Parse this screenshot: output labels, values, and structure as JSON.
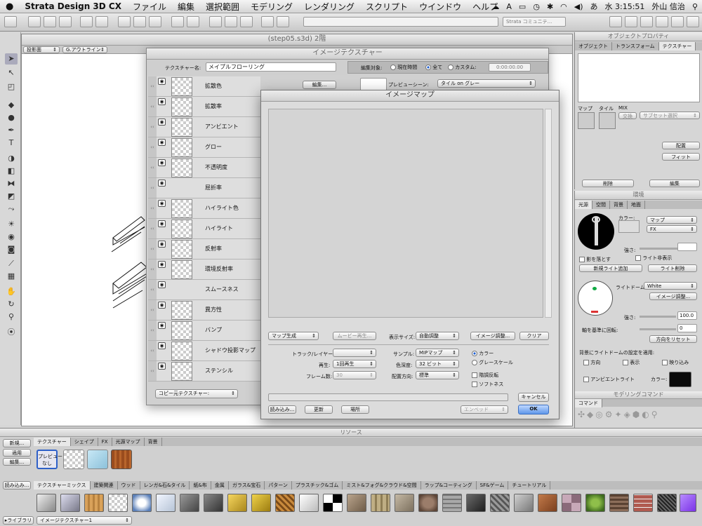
{
  "menubar": {
    "app": "Strata Design 3D CX",
    "items": [
      "ファイル",
      "編集",
      "選択範囲",
      "モデリング",
      "レンダリング",
      "スクリプト",
      "ウインドウ",
      "ヘルプ"
    ],
    "clock": "水 3:15:51",
    "user": "外山 信治"
  },
  "toolbar": {
    "search_placeholder": "Strata コミュニテ..."
  },
  "viewport": {
    "title": "(step05.s3d) 2階",
    "view_popup": "投影面",
    "render_popup": "G.アウトライン"
  },
  "image_texture": {
    "title": "イメージテクスチャー",
    "name_label": "テクスチャー名:",
    "name_value": "メイプルフローリング",
    "edit_target_label": "編集対象:",
    "target_current": "現在時間",
    "target_all": "全て",
    "target_custom": "カスタム:",
    "time_value": "0:00:00.00",
    "preview_label": "プレビューシーン:",
    "preview_value": "タイル on グレー",
    "edit_button": "編集...",
    "channels": [
      "拡散色",
      "拡散率",
      "アンビエント",
      "グロー",
      "不透明度",
      "屈折率",
      "ハイライト色",
      "ハイライト",
      "反射率",
      "環境反射率",
      "スムースネス",
      "異方性",
      "バンプ",
      "シャドウ投影マップ",
      "ステンシル"
    ],
    "copy_source": "コピー元テクスチャー:"
  },
  "image_map": {
    "title": "イメージマップ",
    "map_create": "マップ生成",
    "movie_play": "ムービー再生...",
    "display_size_label": "表示サイズ:",
    "display_size": "自動調整",
    "image_adjust": "イメージ調整...",
    "clear": "クリア",
    "track_label": "トラック/レイヤー:",
    "playback_label": "再生:",
    "playback_value": "1回再生",
    "frames_label": "フレーム数:",
    "frames_value": "30",
    "sample_label": "サンプル:",
    "sample_value": "MIPマップ",
    "depth_label": "色深度:",
    "depth_value": "32 ビット",
    "direction_label": "配置方向:",
    "direction_value": "標準",
    "color": "カラー",
    "grayscale": "グレースケール",
    "invert": "階調反転",
    "softness": "ソフトネス",
    "load": "読み込み...",
    "update": "更新",
    "location": "場所",
    "import": "エンベッド",
    "cancel": "キャンセル",
    "ok": "OK"
  },
  "properties": {
    "title": "オブジェクトプロパティ",
    "tabs": [
      "オブジェクト",
      "トランスフォーム",
      "テクスチャー"
    ],
    "map_labels": [
      "マップ",
      "タイル",
      "MIX"
    ],
    "swap": "交換",
    "subset": "サブセット選択",
    "place": "配置",
    "fit": "フィット",
    "delete": "削除",
    "edit": "編集"
  },
  "environment": {
    "title": "環境",
    "tabs": [
      "光源",
      "空間",
      "背景",
      "地面"
    ],
    "color_label": "カラー:",
    "map_popup": "マップ",
    "fx_popup": "FX",
    "strength_label": "強さ:",
    "cast_shadow": "影を落とす",
    "light_hidden": "ライト非表示",
    "add_light": "新規ライト追加",
    "delete_light": "ライト削除",
    "dome_label": "ライトドーム:",
    "dome_value": "White",
    "image_adjust": "イメージ調整...",
    "strength2_label": "強さ:",
    "strength_value": "100.0",
    "rotate_label": "軸を基準に回転:",
    "rotate_value": "0",
    "reset_direction": "方向をリセット",
    "apply_label": "背景にライトドームの設定を適用:",
    "apply_direction": "方向",
    "apply_show": "表示",
    "apply_blur": "映り込み",
    "ambient": "アンビエントライト",
    "ambient_color_label": "カラー:"
  },
  "modeling": {
    "title": "モデリングコマンド",
    "tab": "コマンド"
  },
  "resources": {
    "title": "リソース",
    "tabs": [
      "テクスチャー",
      "シェイプ",
      "FX",
      "光源マップ",
      "背景"
    ],
    "new": "新規...",
    "apply": "適用",
    "edit": "編集...",
    "preview_none": "プレビュー\nなし",
    "load": "読み込み...",
    "lib_tabs": [
      "テクスチャーミックス",
      "建築関連",
      "ウッド",
      "レンガ&石&タイル",
      "紙&布",
      "金属",
      "ガラス&宝石",
      "パターン",
      "プラスチック&ゴム",
      "ミスト&フォグ&クラウド&空間",
      "ラップ&コーティング",
      "SF&ゲーム",
      "チュートリアル"
    ],
    "library_label": "▸ライブラリ",
    "library_value": "イメージテクスチャー1"
  },
  "colors": {
    "accent": "#1f5fd0",
    "panel": "#d6d6d6",
    "dialog": "#dcdcdc"
  }
}
